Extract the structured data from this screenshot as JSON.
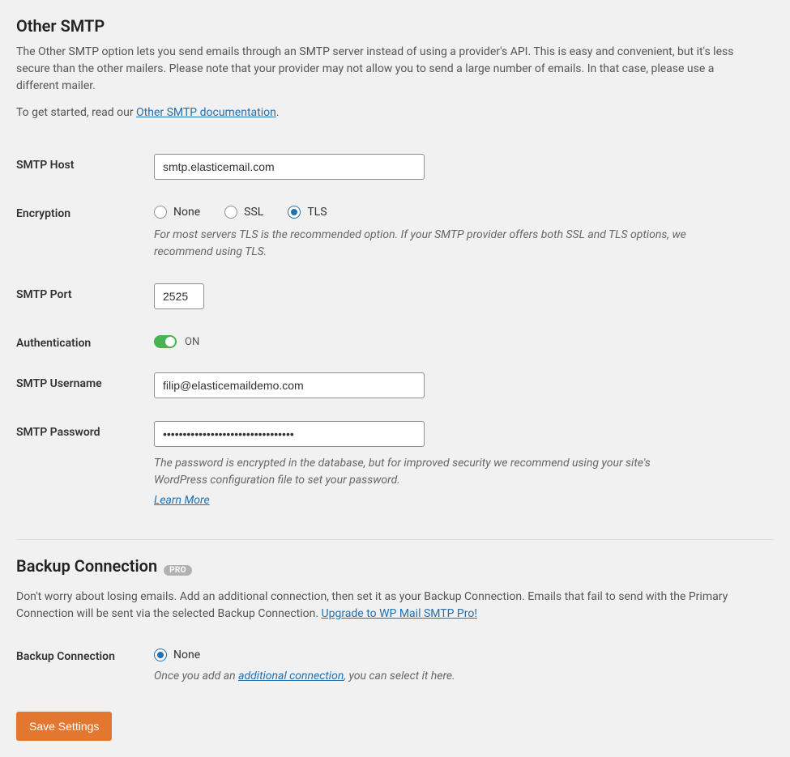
{
  "section1": {
    "title": "Other SMTP",
    "desc": "The Other SMTP option lets you send emails through an SMTP server instead of using a provider's API. This is easy and convenient, but it's less secure than the other mailers. Please note that your provider may not allow you to send a large number of emails. In that case, please use a different mailer.",
    "get_started_prefix": "To get started, read our ",
    "doc_link": "Other SMTP documentation",
    "get_started_suffix": "."
  },
  "smtp_host": {
    "label": "SMTP Host",
    "value": "smtp.elasticemail.com"
  },
  "encryption": {
    "label": "Encryption",
    "options": {
      "none": "None",
      "ssl": "SSL",
      "tls": "TLS"
    },
    "selected": "tls",
    "help": "For most servers TLS is the recommended option. If your SMTP provider offers both SSL and TLS options, we recommend using TLS."
  },
  "smtp_port": {
    "label": "SMTP Port",
    "value": "2525"
  },
  "auth": {
    "label": "Authentication",
    "state": "ON"
  },
  "smtp_user": {
    "label": "SMTP Username",
    "value": "filip@elasticemaildemo.com"
  },
  "smtp_pass": {
    "label": "SMTP Password",
    "value": "•••••••••••••••••••••••••••••••••",
    "help": "The password is encrypted in the database, but for improved security we recommend using your site's WordPress configuration file to set your password.",
    "learn_more": "Learn More"
  },
  "backup_section": {
    "title": "Backup Connection",
    "badge": "PRO",
    "desc_prefix": "Don't worry about losing emails. Add an additional connection, then set it as your Backup Connection. Emails that fail to send with the Primary Connection will be sent via the selected Backup Connection. ",
    "upgrade_link": "Upgrade to WP Mail SMTP Pro!"
  },
  "backup_conn": {
    "label": "Backup Connection",
    "option_none": "None",
    "help_prefix": "Once you add an ",
    "help_link": "additional connection",
    "help_suffix": ", you can select it here."
  },
  "save_label": "Save Settings"
}
